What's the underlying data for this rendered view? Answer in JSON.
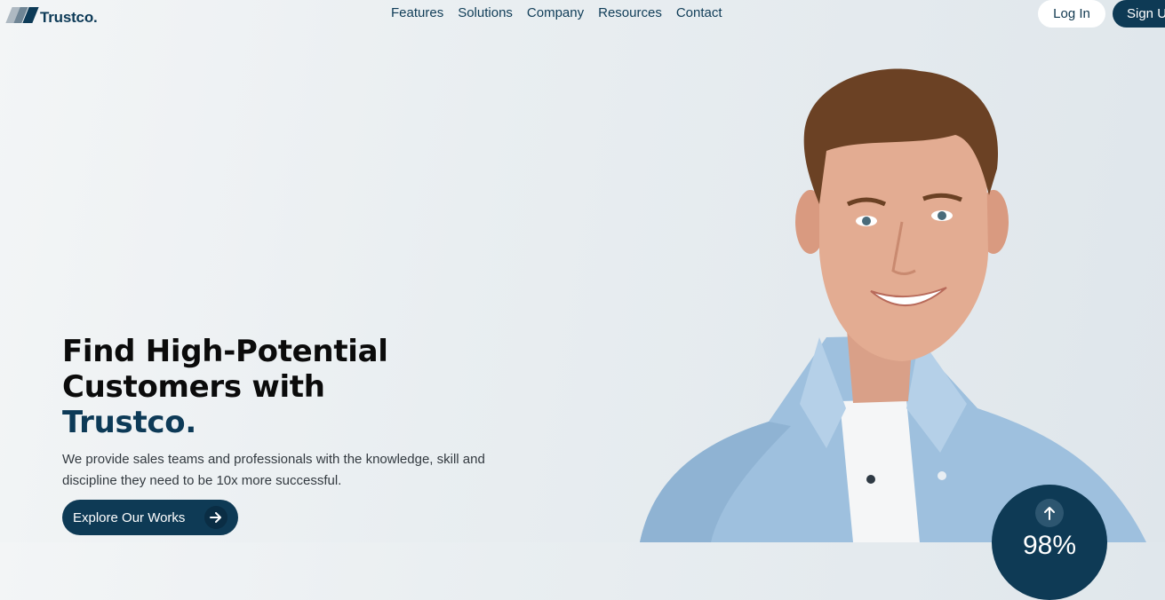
{
  "brand": {
    "name": "Trustco."
  },
  "nav": {
    "links": [
      "Features",
      "Solutions",
      "Company",
      "Resources",
      "Contact"
    ],
    "login_label": "Log In",
    "signup_label": "Sign Up"
  },
  "hero": {
    "title_line1": "Find High-Potential",
    "title_line2": "Customers with",
    "title_brand": "Trustco.",
    "description": "We provide sales teams and professionals with the knowledge, skill and discipline they need to be 10x more successful.",
    "cta_label": "Explore Our Works"
  },
  "stat": {
    "value": "98%"
  },
  "icons": [
    "logo-icon",
    "arrow-right-icon",
    "arrow-up-icon"
  ],
  "colors": {
    "primary": "#0e3a55",
    "text": "#0b0b0b",
    "background": "#e9eef1"
  }
}
